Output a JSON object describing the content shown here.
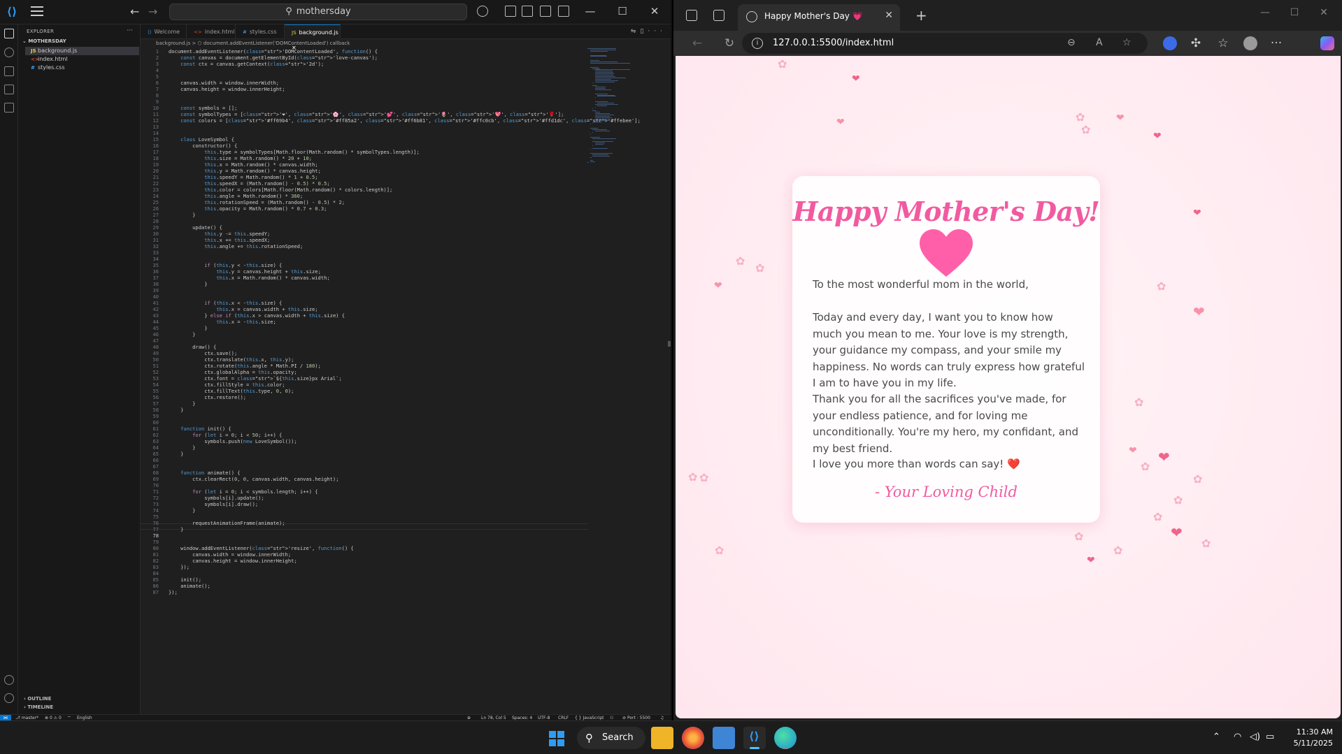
{
  "vscode": {
    "search": "mothersday",
    "explorer_title": "EXPLORER",
    "folder": "MOTHERSDAY",
    "files": [
      "background.js",
      "index.html",
      "styles.css"
    ],
    "outline": "OUTLINE",
    "timeline": "TIMELINE",
    "tabs": [
      "Welcome",
      "index.html",
      "styles.css",
      "background.js"
    ],
    "breadcrumb": "background.js > ⬡ document.addEventListener('DOMContentLoaded') callback",
    "code_lines": [
      "document.addEventListener('DOMContentLoaded', function() {",
      "    const canvas = document.getElementById('love-canvas');",
      "    const ctx = canvas.getContext('2d');",
      "",
      "",
      "    canvas.width = window.innerWidth;",
      "    canvas.height = window.innerHeight;",
      "",
      "",
      "    const symbols = [];",
      "    const symbolTypes = ['❤', '🌸', '💕', '🌷', '💖', '🌹'];",
      "    const colors = ['#ff69b4', '#ff85a2', '#ff6b81', '#ffc0cb', '#ffd1dc', '#ffebee'];",
      "",
      "",
      "    class LoveSymbol {",
      "        constructor() {",
      "            this.type = symbolTypes[Math.floor(Math.random() * symbolTypes.length)];",
      "            this.size = Math.random() * 20 + 10;",
      "            this.x = Math.random() * canvas.width;",
      "            this.y = Math.random() * canvas.height;",
      "            this.speedY = Math.random() * 1 + 0.5;",
      "            this.speedX = (Math.random() - 0.5) * 0.5;",
      "            this.color = colors[Math.floor(Math.random() * colors.length)];",
      "            this.angle = Math.random() * 360;",
      "            this.rotationSpeed = (Math.random() - 0.5) * 2;",
      "            this.opacity = Math.random() * 0.7 + 0.3;",
      "        }",
      "",
      "        update() {",
      "            this.y -= this.speedY;",
      "            this.x += this.speedX;",
      "            this.angle += this.rotationSpeed;",
      "",
      "",
      "            if (this.y < -this.size) {",
      "                this.y = canvas.height + this.size;",
      "                this.x = Math.random() * canvas.width;",
      "            }",
      "",
      "",
      "            if (this.x < -this.size) {",
      "                this.x = canvas.width + this.size;",
      "            } else if (this.x > canvas.width + this.size) {",
      "                this.x = -this.size;",
      "            }",
      "        }",
      "",
      "        draw() {",
      "            ctx.save();",
      "            ctx.translate(this.x, this.y);",
      "            ctx.rotate(this.angle * Math.PI / 180);",
      "            ctx.globalAlpha = this.opacity;",
      "            ctx.font = `${this.size}px Arial`;",
      "            ctx.fillStyle = this.color;",
      "            ctx.fillText(this.type, 0, 0);",
      "            ctx.restore();",
      "        }",
      "    }",
      "",
      "",
      "    function init() {",
      "        for (let i = 0; i < 50; i++) {",
      "            symbols.push(new LoveSymbol());",
      "        }",
      "    }",
      "",
      "",
      "    function animate() {",
      "        ctx.clearRect(0, 0, canvas.width, canvas.height);",
      "",
      "        for (let i = 0; i < symbols.length; i++) {",
      "            symbols[i].update();",
      "            symbols[i].draw();",
      "        }",
      "",
      "        requestAnimationFrame(animate);",
      "    }",
      "",
      "",
      "    window.addEventListener('resize', function() {",
      "        canvas.width = window.innerWidth;",
      "        canvas.height = window.innerHeight;",
      "    });",
      "",
      "    init();",
      "    animate();",
      "});"
    ],
    "status": {
      "branch": "master*",
      "errors": "0",
      "warnings": "0",
      "language_pack": "English",
      "position": "Ln 78, Col 5",
      "spaces": "Spaces: 4",
      "encoding": "UTF-8",
      "eol": "CRLF",
      "language": "JavaScript",
      "port": "Port : 5500"
    }
  },
  "browser": {
    "tab_title": "Happy Mother's Day 💗",
    "url": "127.0.0.1:5500/index.html",
    "page": {
      "title": "Happy Mother's Day!",
      "greeting": "To the most wonderful mom in the world,",
      "para1": "Today and every day, I want you to know how much you mean to me. Your love is my strength, your guidance my compass, and your smile my happiness. No words can truly express how grateful I am to have you in my life.",
      "para2": "Thank you for all the sacrifices you've made, for your endless patience, and for loving me unconditionally. You're my hero, my confidant, and my best friend.",
      "para3": "I love you more than words can say!",
      "para3_emoji": "❤️",
      "signature": "- Your Loving Child"
    }
  },
  "taskbar": {
    "search": "Search",
    "time": "11:30 AM",
    "date": "5/11/2025"
  },
  "colors": {
    "vscode_bg": "#1f1f1f",
    "accent_blue": "#0078d4",
    "page_pink": "#f25aa0",
    "heart": "#ff5fa8"
  }
}
